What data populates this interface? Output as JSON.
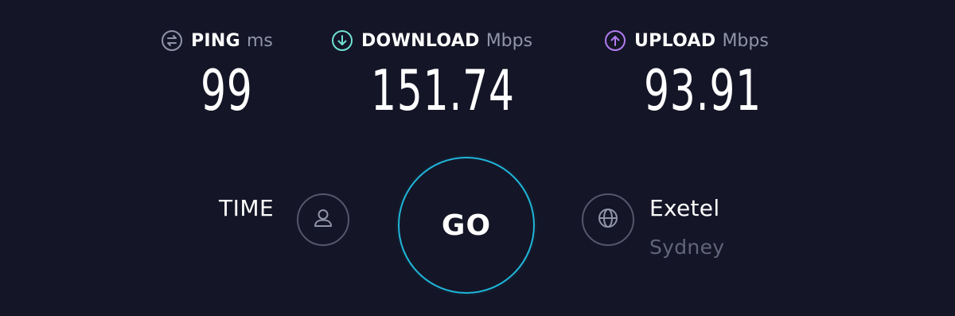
{
  "metrics": {
    "ping": {
      "label": "PING",
      "unit": "ms",
      "value": "99",
      "icon": "ping-icon",
      "color": "#9193a8"
    },
    "download": {
      "label": "DOWNLOAD",
      "unit": "Mbps",
      "value": "151.74",
      "icon": "download-arrow-icon",
      "color": "#6fe0d1"
    },
    "upload": {
      "label": "UPLOAD",
      "unit": "Mbps",
      "value": "93.91",
      "icon": "upload-arrow-icon",
      "color": "#b27cf0"
    }
  },
  "time": {
    "label": "TIME"
  },
  "go_button": {
    "label": "GO",
    "ring_color": "#1fb5d8"
  },
  "server": {
    "isp": "Exetel",
    "location": "Sydney"
  },
  "colors": {
    "background": "#141526",
    "muted_text": "#9193a8",
    "icon_border": "#55566b"
  }
}
